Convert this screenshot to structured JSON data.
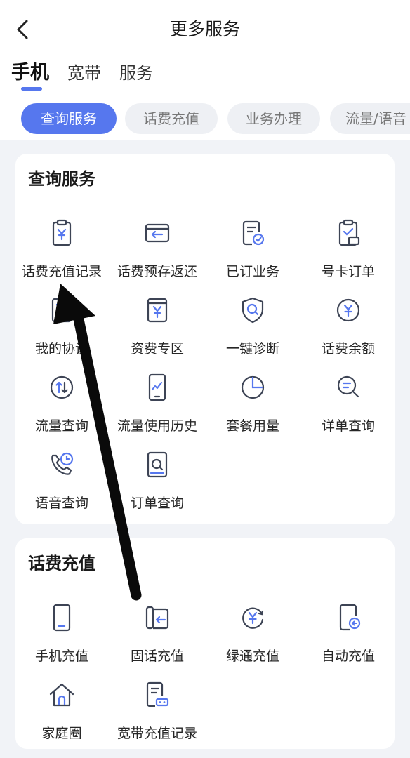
{
  "header": {
    "title": "更多服务"
  },
  "category_tabs": [
    {
      "label": "手机",
      "active": true
    },
    {
      "label": "宽带",
      "active": false
    },
    {
      "label": "服务",
      "active": false
    }
  ],
  "chips": [
    {
      "label": "查询服务",
      "active": true
    },
    {
      "label": "话费充值",
      "active": false
    },
    {
      "label": "业务办理",
      "active": false
    },
    {
      "label": "流量/语音",
      "active": false
    }
  ],
  "sections": {
    "query": {
      "title": "查询服务",
      "items": [
        {
          "label": "话费充值记录",
          "icon": "clipboard-yuan-icon"
        },
        {
          "label": "话费预存返还",
          "icon": "card-return-icon"
        },
        {
          "label": "已订业务",
          "icon": "document-check-icon"
        },
        {
          "label": "号卡订单",
          "icon": "sim-order-icon"
        },
        {
          "label": "我的协议",
          "icon": "agreement-icon"
        },
        {
          "label": "资费专区",
          "icon": "book-yuan-icon"
        },
        {
          "label": "一键诊断",
          "icon": "shield-search-icon"
        },
        {
          "label": "话费余额",
          "icon": "yuan-circle-icon"
        },
        {
          "label": "流量查询",
          "icon": "data-arrows-icon"
        },
        {
          "label": "流量使用历史",
          "icon": "phone-chart-icon"
        },
        {
          "label": "套餐用量",
          "icon": "pie-chart-icon"
        },
        {
          "label": "详单查询",
          "icon": "search-list-icon"
        },
        {
          "label": "语音查询",
          "icon": "phone-clock-icon"
        },
        {
          "label": "订单查询",
          "icon": "order-search-icon"
        }
      ]
    },
    "recharge": {
      "title": "话费充值",
      "items": [
        {
          "label": "手机充值",
          "icon": "mobile-phone-icon"
        },
        {
          "label": "固话充值",
          "icon": "landline-icon"
        },
        {
          "label": "绿通充值",
          "icon": "yuan-refresh-icon"
        },
        {
          "label": "自动充值",
          "icon": "phone-auto-icon"
        },
        {
          "label": "家庭圈",
          "icon": "home-icon"
        },
        {
          "label": "宽带充值记录",
          "icon": "broadband-record-icon"
        }
      ]
    }
  },
  "colors": {
    "accent": "#5677ee",
    "icon_stroke": "#3d4455",
    "icon_highlight": "#5677ee"
  }
}
